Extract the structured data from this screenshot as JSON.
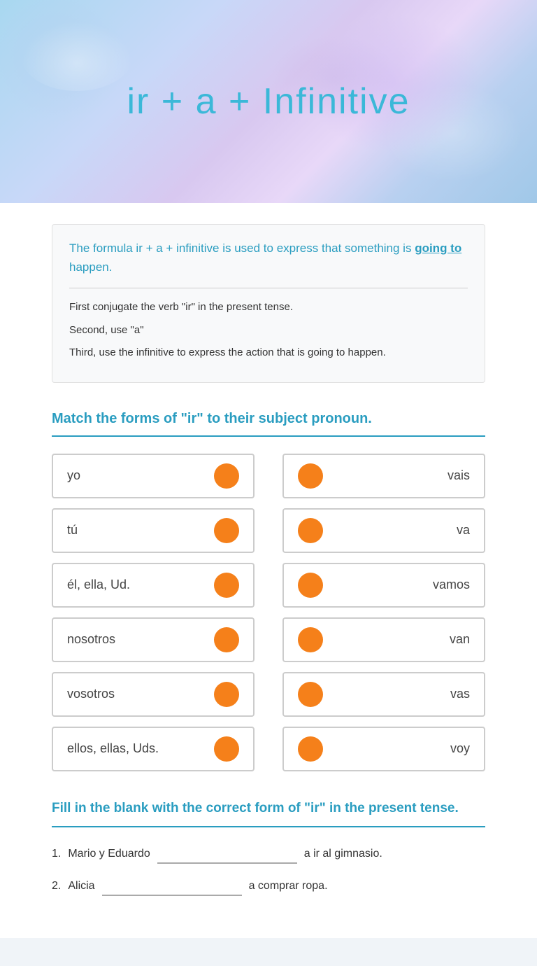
{
  "header": {
    "title": "ir + a + Infinitive"
  },
  "formula": {
    "highlight_text": "The formula ir + a + infinitive is used to express that something is going to happen.",
    "going_to": "going to",
    "steps": [
      "First conjugate the verb \"ir\" in the present tense.",
      "Second, use \"a\"",
      "Third, use the infinitive to express the action that is going to happen."
    ]
  },
  "match_section": {
    "heading": "Match the forms of \"ir\" to their subject pronoun.",
    "left_items": [
      "yo",
      "tú",
      "él, ella, Ud.",
      "nosotros",
      "vosotros",
      "ellos, ellas, Uds."
    ],
    "right_items": [
      "vais",
      "va",
      "vamos",
      "van",
      "vas",
      "voy"
    ]
  },
  "fill_section": {
    "heading": "Fill in the blank with the correct form of \"ir\" in the present tense.",
    "questions": [
      {
        "number": "1.",
        "before": "Mario y Eduardo",
        "after": "a ir al gimnasio."
      },
      {
        "number": "2.",
        "before": "Alicia",
        "after": "a comprar ropa."
      }
    ]
  }
}
